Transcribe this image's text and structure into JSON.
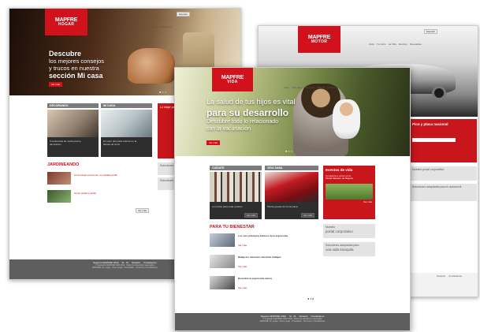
{
  "common": {
    "nav": [
      "Inicio",
      "Vida Sana",
      "Bienestar",
      "Belleza",
      "Eventos"
    ],
    "lang": "Español",
    "ver_mas": "Ver más",
    "footer_links": [
      "Seguros MAPFRE VIDA",
      "Sí · Sí",
      "Glosario",
      "Contactanos"
    ],
    "footer_copy": [
      "© Copyright MAPFRE VIDA 2011. Todos los derechos reservados.",
      "MAPFRE, Av. Legal · Aviso Legal · Privacidad · Términos y Condiciones"
    ]
  },
  "hogar": {
    "logo_top": "MAPFRE",
    "logo_bottom": "HOGAR",
    "nav": [
      "Inicio",
      "Mi Casa",
      "Jardineando",
      "Cocina",
      "Decorando"
    ],
    "hero_lines": [
      "Descubre",
      "los mejores consejos",
      "y trucos en nuestra",
      "sección Mi casa"
    ],
    "sections": [
      "DECORANDO",
      "MI CASA"
    ],
    "thumb_captions": [
      "5 tendencias de moda para tu decoración",
      "El mejor plan para ahorrar en la factura de la luz"
    ],
    "red_panel_title": "Lo mejor para tu hogar",
    "jardineando_title": "JARDINEANDO",
    "articles": [
      "10 Consejos para tener un cuidado jardín",
      "Cómo podar tu jardín"
    ],
    "gray_boxes": [
      "Soluciones para tu hogar",
      "Soluciones para tu casa"
    ]
  },
  "motor": {
    "logo_top": "MAPFRE",
    "logo_bottom": "MOTOR",
    "nav": [
      "Inicio",
      "Tu Carro",
      "La Vida",
      "Eventos",
      "Novedades"
    ],
    "red_panel_title": "Pico y placa nacional",
    "gray_boxes": [
      "Nuestro portal corporativo",
      "Soluciones adaptadas para tu automóvil"
    ],
    "footer_links": [
      "Glosario",
      "Contactanos"
    ]
  },
  "vida": {
    "logo_top": "MAPFRE",
    "logo_bottom": "VIDA",
    "hero_lines": [
      "La salud de tus hijos es vital",
      "para su desarrollo",
      "Descubre todo lo relacionado",
      "con la vacunación"
    ],
    "sections": [
      "CUÍDATE",
      "VIDA SANA"
    ],
    "thumb_captions": [
      "Los todos para cada ocasión",
      "Pierde grasas de forma sana"
    ],
    "events_title": "Eventos de vida",
    "events_text": [
      "Comienza a correr en la",
      "Media Maratón de Bogotá"
    ],
    "bienestar_title": "PARA TU BIENESTAR",
    "articles": [
      "Los seis principios básicos de la ergonomía",
      "Relaja los músculos mientras trabajas",
      "Descubre la ergonomía eterna"
    ],
    "gray_boxes": [
      {
        "line1": "Nuestro",
        "line2": "portal corporativo"
      },
      {
        "line1": "Soluciones adaptadas para",
        "line2": "una vida tranquila"
      }
    ],
    "pager": "◂ 1 ▸"
  }
}
